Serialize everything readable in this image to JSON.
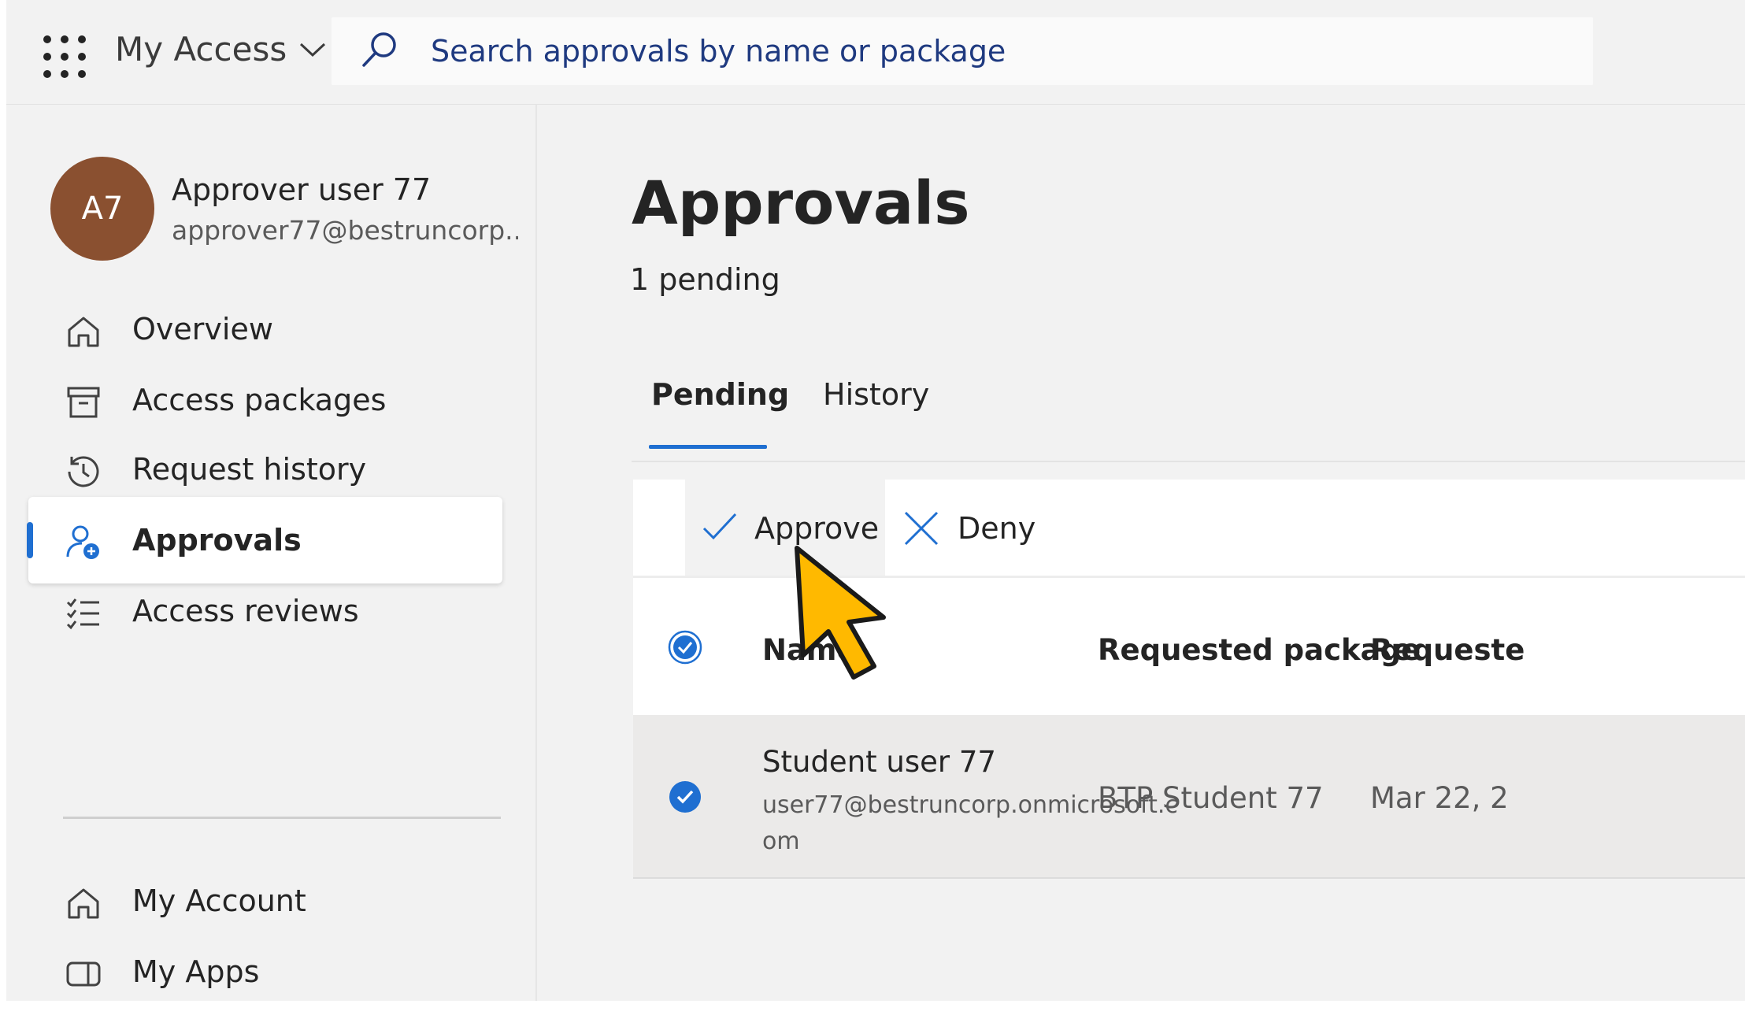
{
  "header": {
    "app_title": "My Access",
    "search_placeholder": "Search approvals by name or package"
  },
  "user": {
    "initials": "A7",
    "name": "Approver user 77",
    "email": "approver77@bestruncorp...."
  },
  "sidebar": {
    "items": [
      {
        "label": "Overview",
        "icon": "home-icon"
      },
      {
        "label": "Access packages",
        "icon": "package-icon"
      },
      {
        "label": "Request history",
        "icon": "history-icon"
      },
      {
        "label": "Approvals",
        "icon": "person-add-icon",
        "active": true
      },
      {
        "label": "Access reviews",
        "icon": "checklist-icon"
      },
      {
        "label": "My Account",
        "icon": "home-icon"
      },
      {
        "label": "My Apps",
        "icon": "apps-icon"
      }
    ]
  },
  "main": {
    "title": "Approvals",
    "pending_count": "1 pending",
    "tabs": [
      {
        "label": "Pending",
        "selected": true
      },
      {
        "label": "History",
        "selected": false
      }
    ],
    "toolbar": {
      "approve_label": "Approve",
      "deny_label": "Deny"
    },
    "table": {
      "columns": [
        "Name",
        "Requested package",
        "Requeste"
      ],
      "rows": [
        {
          "name": "Student user 77",
          "email": "user77@bestruncorp.onmicrosoft.com",
          "package": "BTP Student 77",
          "date": "Mar 22, 2",
          "selected": true
        }
      ]
    }
  },
  "colors": {
    "accent": "#1f6fd1",
    "avatar": "#8a5030",
    "cursor": "#ffb900"
  }
}
